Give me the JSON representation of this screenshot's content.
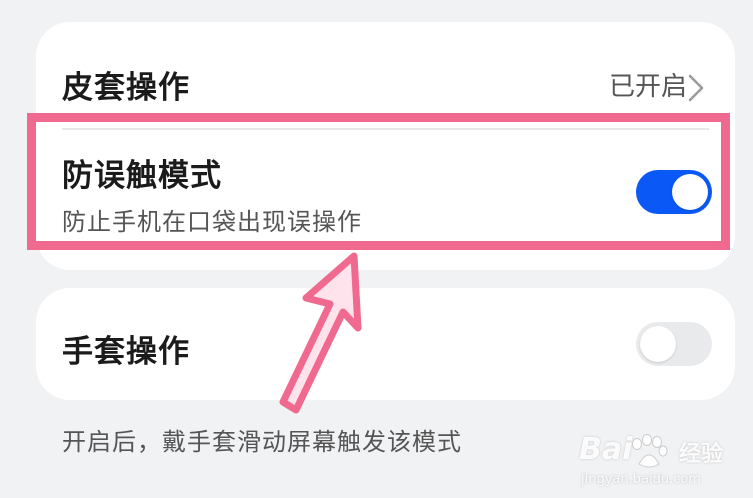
{
  "settings": {
    "case_operation": {
      "title": "皮套操作",
      "status": "已开启"
    },
    "anti_mistouch": {
      "title": "防误触模式",
      "subtitle": "防止手机在口袋出现误操作",
      "enabled": true
    },
    "glove_operation": {
      "title": "手套操作",
      "enabled": false,
      "description": "开启后，戴手套滑动屏幕触发该模式"
    }
  },
  "colors": {
    "toggle_on": "#0a59f7",
    "toggle_off": "#e9eaec",
    "highlight": "#f06a8f",
    "background": "#f1f2f4"
  },
  "watermark": {
    "logo": "Bai",
    "logo_suffix": "经验",
    "url": "jingyan.baidu.com"
  }
}
